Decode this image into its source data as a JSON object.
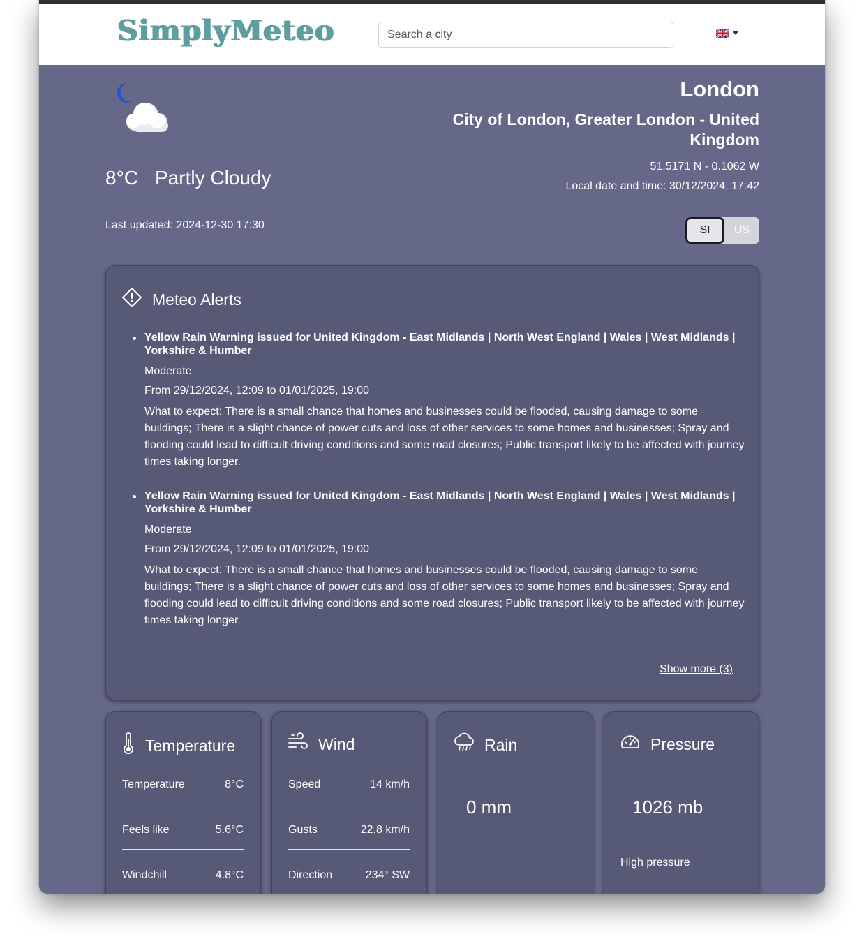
{
  "header": {
    "logo": "SimplyMeteo",
    "search_placeholder": "Search a city",
    "language": "en-GB"
  },
  "current": {
    "temperature": "8°C",
    "condition": "Partly Cloudy",
    "last_updated_label": "Last updated:",
    "last_updated": "2024-12-30 17:30",
    "weather_icon": "partly-cloudy-night-icon"
  },
  "location": {
    "city": "London",
    "region": "City of London, Greater London - United Kingdom",
    "coords": "51.5171 N - 0.1062 W",
    "local_time": "Local date and time: 30/12/2024, 17:42"
  },
  "units": {
    "si": "SI",
    "us": "US",
    "selected": "SI"
  },
  "alerts": {
    "title": "Meteo Alerts",
    "items": [
      {
        "title": "Yellow Rain Warning issued for United Kingdom - East Midlands | North West England | Wales | West Midlands | Yorkshire & Humber",
        "severity": "Moderate",
        "period": "From 29/12/2024, 12:09 to 01/01/2025, 19:00",
        "description": "What to expect: There is a small chance that homes and businesses could be flooded, causing damage to some buildings; There is a slight chance of power cuts and loss of other services to some homes and businesses; Spray and flooding could lead to difficult driving conditions and some road closures; Public transport likely to be affected with journey times taking longer."
      },
      {
        "title": "Yellow Rain Warning issued for United Kingdom - East Midlands | North West England | Wales | West Midlands | Yorkshire & Humber",
        "severity": "Moderate",
        "period": "From 29/12/2024, 12:09 to 01/01/2025, 19:00",
        "description": "What to expect: There is a small chance that homes and businesses could be flooded, causing damage to some buildings; There is a slight chance of power cuts and loss of other services to some homes and businesses; Spray and flooding could lead to difficult driving conditions and some road closures; Public transport likely to be affected with journey times taking longer."
      }
    ],
    "show_more": "Show more (3)"
  },
  "cards": {
    "temperature": {
      "title": "Temperature",
      "rows": [
        {
          "label": "Temperature",
          "value": "8°C"
        },
        {
          "label": "Feels like",
          "value": "5.6°C"
        },
        {
          "label": "Windchill",
          "value": "4.8°C"
        }
      ]
    },
    "wind": {
      "title": "Wind",
      "rows": [
        {
          "label": "Speed",
          "value": "14 km/h"
        },
        {
          "label": "Gusts",
          "value": "22.8 km/h"
        },
        {
          "label": "Direction",
          "value": "234° SW"
        }
      ]
    },
    "rain": {
      "title": "Rain",
      "value": "0 mm"
    },
    "pressure": {
      "title": "Pressure",
      "value": "1026 mb",
      "note": "High pressure"
    }
  },
  "colors": {
    "page_bg": "#656888",
    "card_bg": "#575a77",
    "logo": "#5f9ea0"
  }
}
